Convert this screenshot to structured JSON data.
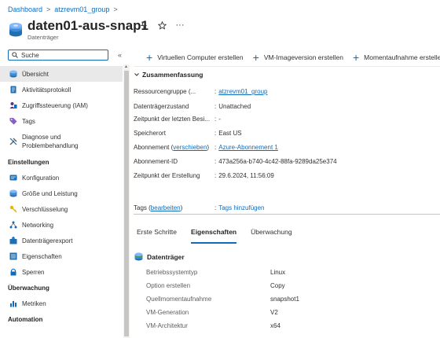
{
  "breadcrumb": {
    "items": [
      "Dashboard",
      "atzrevm01_group"
    ]
  },
  "header": {
    "title": "daten01-aus-snap1",
    "subtitle": "Datenträger"
  },
  "sidebar": {
    "search_placeholder": "Suche",
    "collapse_label": "«",
    "items_top": [
      {
        "label": "Übersicht",
        "icon": "disk-icon"
      },
      {
        "label": "Aktivitätsprotokoll",
        "icon": "activity-log-icon"
      },
      {
        "label": "Zugriffssteuerung (IAM)",
        "icon": "iam-icon"
      },
      {
        "label": "Tags",
        "icon": "tag-icon"
      },
      {
        "label": "Diagnose und Problembehandlung",
        "icon": "diagnose-icon"
      }
    ],
    "section_settings": "Einstellungen",
    "items_settings": [
      {
        "label": "Konfiguration",
        "icon": "configuration-icon"
      },
      {
        "label": "Größe und Leistung",
        "icon": "size-performance-icon"
      },
      {
        "label": "Verschlüsselung",
        "icon": "key-icon"
      },
      {
        "label": "Networking",
        "icon": "networking-icon"
      },
      {
        "label": "Datenträgerexport",
        "icon": "export-icon"
      },
      {
        "label": "Eigenschaften",
        "icon": "properties-icon"
      },
      {
        "label": "Sperren",
        "icon": "lock-icon"
      }
    ],
    "section_monitoring": "Überwachung",
    "items_monitoring": [
      {
        "label": "Metriken",
        "icon": "metrics-icon"
      }
    ],
    "section_automation": "Automation"
  },
  "toolbar": {
    "create_vm": "Virtuellen Computer erstellen",
    "create_image": "VM-Imageversion erstellen",
    "create_snapshot": "Momentaufnahme erstellen"
  },
  "essentials": {
    "title": "Zusammenfassung",
    "resource_group_label": "Ressourcengruppe (...",
    "resource_group_value": "atzrevm01_group",
    "disk_state_label": "Datenträgerzustand",
    "disk_state_value": "Unattached",
    "last_owner_label": "Zeitpunkt der letzten Besi...",
    "last_owner_value": "-",
    "location_label": "Speicherort",
    "location_value": "East US",
    "subscription_label": "Abonnement",
    "subscription_move": "verschieben",
    "subscription_value": "Azure-Abonnement 1",
    "subscription_id_label": "Abonnement-ID",
    "subscription_id_value": "473a256a-b740-4c42-88fa-9289da25e374",
    "created_label": "Zeitpunkt der Erstellung",
    "created_value": "29.6.2024, 11:56:09",
    "tags_label": "Tags",
    "tags_edit": "bearbeiten",
    "tags_add": "Tags hinzufügen"
  },
  "tabs": [
    "Erste Schritte",
    "Eigenschaften",
    "Überwachung"
  ],
  "properties": {
    "title": "Datenträger",
    "rows": [
      {
        "label": "Betriebssystemtyp",
        "value": "Linux"
      },
      {
        "label": "Option erstellen",
        "value": "Copy"
      },
      {
        "label": "Quellmomentaufnahme",
        "value": "snapshot1"
      },
      {
        "label": "VM-Generation",
        "value": "V2"
      },
      {
        "label": "VM-Architektur",
        "value": "x64"
      }
    ]
  },
  "colors": {
    "accent": "#0f6cbd",
    "active_bg": "#e9e9e9"
  }
}
